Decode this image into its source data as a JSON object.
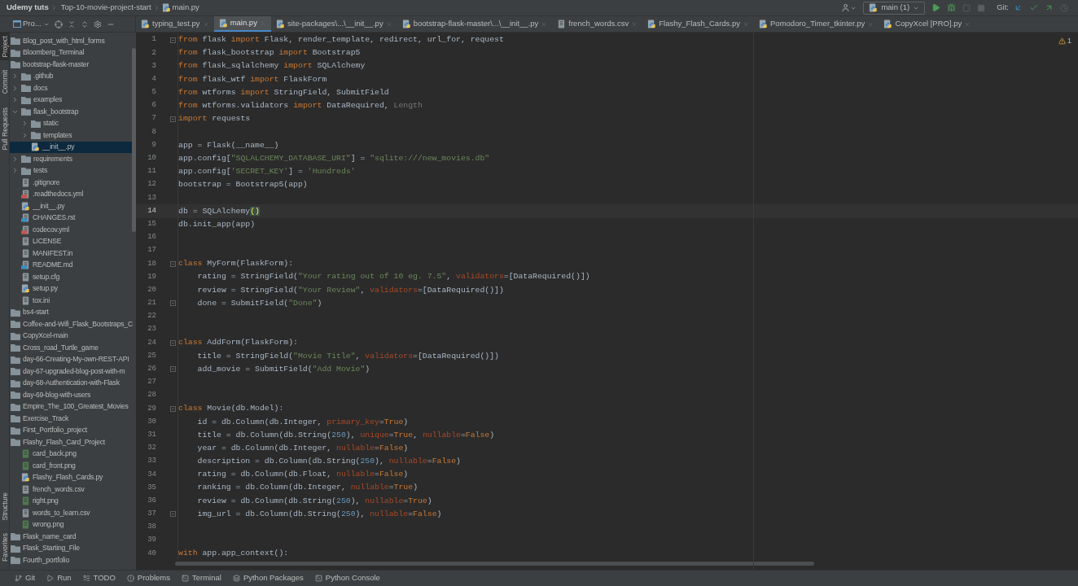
{
  "navbar": {
    "breadcrumbs": [
      {
        "text": "Udemy tuts",
        "kind": "project"
      },
      {
        "text": "Top-10-movie-project-start",
        "kind": "folder"
      },
      {
        "text": "main.py",
        "kind": "file"
      }
    ],
    "run_config": "main (1)",
    "git_label": "Git:"
  },
  "project_panel": {
    "title": "Pro..."
  },
  "tabs": [
    {
      "label": "typing_test.py",
      "kind": "python",
      "selected": false
    },
    {
      "label": "main.py",
      "kind": "python",
      "selected": true
    },
    {
      "label": "site-packages\\...\\__init__.py",
      "kind": "python",
      "selected": false
    },
    {
      "label": "bootstrap-flask-master\\...\\__init__.py",
      "kind": "python",
      "selected": false
    },
    {
      "label": "french_words.csv",
      "kind": "text",
      "selected": false
    },
    {
      "label": "Flashy_Flash_Cards.py",
      "kind": "python",
      "selected": false
    },
    {
      "label": "Pomodoro_Timer_tkinter.py",
      "kind": "python",
      "selected": false
    },
    {
      "label": "CopyXcel [PRO].py",
      "kind": "python",
      "selected": false
    }
  ],
  "tool_stripe": {
    "top": [
      {
        "label": "Project",
        "selected": true
      },
      {
        "label": "Commit",
        "selected": false
      },
      {
        "label": "Pull Requests",
        "selected": false
      }
    ],
    "bottom": [
      {
        "label": "Structure",
        "selected": false
      },
      {
        "label": "Favorites",
        "selected": false
      }
    ]
  },
  "tree": [
    {
      "name": "Blog_post_with_html_forms",
      "kind": "folder",
      "selected": false
    },
    {
      "name": "Bloomberg_Terminal",
      "kind": "folder",
      "selected": false
    },
    {
      "name": "bootstrap-flask-master",
      "kind": "folder",
      "selected": false,
      "children": [
        {
          "name": ".github",
          "kind": "folder",
          "expanded": false,
          "selected": false
        },
        {
          "name": "docs",
          "kind": "folder",
          "expanded": false,
          "selected": false
        },
        {
          "name": "examples",
          "kind": "folder",
          "expanded": false,
          "selected": false
        },
        {
          "name": "flask_bootstrap",
          "kind": "folder",
          "expanded": true,
          "selected": false,
          "children": [
            {
              "name": "static",
              "kind": "folder",
              "expanded": false,
              "selected": false
            },
            {
              "name": "templates",
              "kind": "folder",
              "expanded": false,
              "selected": false
            },
            {
              "name": "__init__.py",
              "kind": "python",
              "selected": true
            }
          ]
        },
        {
          "name": "requirements",
          "kind": "folder",
          "expanded": false,
          "selected": false
        },
        {
          "name": "tests",
          "kind": "folder",
          "expanded": false,
          "selected": false
        },
        {
          "name": ".gitignore",
          "kind": "text",
          "selected": false
        },
        {
          "name": ".readthedocs.yml",
          "kind": "yaml",
          "selected": false
        },
        {
          "name": "__init__.py",
          "kind": "python",
          "selected": false
        },
        {
          "name": "CHANGES.rst",
          "kind": "rst",
          "selected": false
        },
        {
          "name": "codecov.yml",
          "kind": "yaml",
          "selected": false
        },
        {
          "name": "LICENSE",
          "kind": "text",
          "selected": false
        },
        {
          "name": "MANIFEST.in",
          "kind": "text",
          "selected": false
        },
        {
          "name": "README.md",
          "kind": "markdown",
          "selected": false
        },
        {
          "name": "setup.cfg",
          "kind": "text",
          "selected": false
        },
        {
          "name": "setup.py",
          "kind": "python",
          "selected": false
        },
        {
          "name": "tox.ini",
          "kind": "text",
          "selected": false
        }
      ]
    },
    {
      "name": "bs4-start",
      "kind": "folder",
      "selected": false
    },
    {
      "name": "Coffee-and-Wifi_Flask_Bootstraps_C",
      "kind": "folder",
      "selected": false
    },
    {
      "name": "CopyXcel-main",
      "kind": "folder",
      "selected": false
    },
    {
      "name": "Cross_road_Turtle_game",
      "kind": "folder",
      "selected": false
    },
    {
      "name": "day-66-Creating-My-own-REST-API",
      "kind": "folder",
      "selected": false
    },
    {
      "name": "day-67-upgraded-blog-post-with-m",
      "kind": "folder",
      "selected": false
    },
    {
      "name": "day-68-Authentication-with-Flask",
      "kind": "folder",
      "selected": false
    },
    {
      "name": "day-69-blog-with-users",
      "kind": "folder",
      "selected": false
    },
    {
      "name": "Empire_The_100_Greatest_Movies",
      "kind": "folder",
      "selected": false
    },
    {
      "name": "Exercise_Track",
      "kind": "folder",
      "selected": false
    },
    {
      "name": "First_Portfolio_project",
      "kind": "folder",
      "selected": false
    },
    {
      "name": "Flashy_Flash_Card_Project",
      "kind": "folder",
      "selected": false,
      "children": [
        {
          "name": "card_back.png",
          "kind": "image",
          "selected": false
        },
        {
          "name": "card_front.png",
          "kind": "image",
          "selected": false
        },
        {
          "name": "Flashy_Flash_Cards.py",
          "kind": "python",
          "selected": false
        },
        {
          "name": "french_words.csv",
          "kind": "text",
          "selected": false
        },
        {
          "name": "right.png",
          "kind": "image",
          "selected": false
        },
        {
          "name": "words_to_learn.csv",
          "kind": "text",
          "selected": false
        },
        {
          "name": "wrong.png",
          "kind": "image",
          "selected": false
        }
      ]
    },
    {
      "name": "Flask_name_card",
      "kind": "folder",
      "selected": false
    },
    {
      "name": "Flask_Starting_File",
      "kind": "folder",
      "selected": false
    },
    {
      "name": "Fourth_portfolio",
      "kind": "folder",
      "selected": false
    }
  ],
  "editor": {
    "warning_count": "1",
    "lines": [
      {
        "number": "1",
        "current": false,
        "fold": true,
        "tokens": [
          {
            "kind": "kw",
            "text": "from"
          },
          {
            "kind": "txt",
            "text": " flask "
          },
          {
            "kind": "kw",
            "text": "import"
          },
          {
            "kind": "txt",
            "text": " Flask, render_template, redirect, url_for, request"
          }
        ]
      },
      {
        "number": "2",
        "current": false,
        "fold": false,
        "tokens": [
          {
            "kind": "kw",
            "text": "from"
          },
          {
            "kind": "txt",
            "text": " flask_bootstrap "
          },
          {
            "kind": "kw",
            "text": "import"
          },
          {
            "kind": "txt",
            "text": " Bootstrap5"
          }
        ]
      },
      {
        "number": "3",
        "current": false,
        "fold": false,
        "tokens": [
          {
            "kind": "kw",
            "text": "from"
          },
          {
            "kind": "txt",
            "text": " flask_sqlalchemy "
          },
          {
            "kind": "kw",
            "text": "import"
          },
          {
            "kind": "txt",
            "text": " SQLAlchemy"
          }
        ]
      },
      {
        "number": "4",
        "current": false,
        "fold": false,
        "tokens": [
          {
            "kind": "kw",
            "text": "from"
          },
          {
            "kind": "txt",
            "text": " flask_wtf "
          },
          {
            "kind": "kw",
            "text": "import"
          },
          {
            "kind": "txt",
            "text": " FlaskForm"
          }
        ]
      },
      {
        "number": "5",
        "current": false,
        "fold": false,
        "tokens": [
          {
            "kind": "kw",
            "text": "from"
          },
          {
            "kind": "txt",
            "text": " wtforms "
          },
          {
            "kind": "kw",
            "text": "import"
          },
          {
            "kind": "txt",
            "text": " StringField, SubmitField"
          }
        ]
      },
      {
        "number": "6",
        "current": false,
        "fold": false,
        "tokens": [
          {
            "kind": "kw",
            "text": "from"
          },
          {
            "kind": "txt",
            "text": " wtforms.validators "
          },
          {
            "kind": "kw",
            "text": "import"
          },
          {
            "kind": "txt",
            "text": " DataRequired, "
          },
          {
            "kind": "dim",
            "text": "Length"
          }
        ]
      },
      {
        "number": "7",
        "current": false,
        "fold": true,
        "tokens": [
          {
            "kind": "kw",
            "text": "import"
          },
          {
            "kind": "txt",
            "text": " requests"
          }
        ]
      },
      {
        "number": "8",
        "current": false,
        "fold": false
      },
      {
        "number": "9",
        "current": false,
        "fold": false,
        "tokens": [
          {
            "kind": "txt",
            "text": "app = Flask(__name__)"
          }
        ]
      },
      {
        "number": "10",
        "current": false,
        "fold": false,
        "tokens": [
          {
            "kind": "txt",
            "text": "app.config["
          },
          {
            "kind": "str",
            "text": "\"SQLALCHEMY_DATABASE_URI\""
          },
          {
            "kind": "txt",
            "text": "] = "
          },
          {
            "kind": "str",
            "text": "\"sqlite:///new_movies.db\""
          }
        ]
      },
      {
        "number": "11",
        "current": false,
        "fold": false,
        "tokens": [
          {
            "kind": "txt",
            "text": "app.config["
          },
          {
            "kind": "str",
            "text": "'SECRET_KEY'"
          },
          {
            "kind": "txt",
            "text": "] = "
          },
          {
            "kind": "str",
            "text": "'Hundreds'"
          }
        ]
      },
      {
        "number": "12",
        "current": false,
        "fold": false,
        "tokens": [
          {
            "kind": "txt",
            "text": "bootstrap = Bootstrap5(app)"
          }
        ]
      },
      {
        "number": "13",
        "current": false,
        "fold": false
      },
      {
        "number": "14",
        "current": true,
        "fold": false,
        "tokens": [
          {
            "kind": "txt",
            "text": "db = SQLAlchemy"
          },
          {
            "kind": "match",
            "text": "()"
          }
        ]
      },
      {
        "number": "15",
        "current": false,
        "fold": false,
        "tokens": [
          {
            "kind": "txt",
            "text": "db.init_app(app)"
          }
        ]
      },
      {
        "number": "16",
        "current": false,
        "fold": false
      },
      {
        "number": "17",
        "current": false,
        "fold": false
      },
      {
        "number": "18",
        "current": false,
        "fold": true,
        "tokens": [
          {
            "kind": "kw",
            "text": "class"
          },
          {
            "kind": "txt",
            "text": " MyForm(FlaskForm):"
          }
        ]
      },
      {
        "number": "19",
        "current": false,
        "fold": false,
        "tokens": [
          {
            "kind": "txt",
            "text": "    rating = StringField("
          },
          {
            "kind": "str",
            "text": "\"Your rating out of 10 eg. 7.5\""
          },
          {
            "kind": "txt",
            "text": ", "
          },
          {
            "kind": "arg",
            "text": "validators"
          },
          {
            "kind": "txt",
            "text": "=[DataRequired()])"
          }
        ]
      },
      {
        "number": "20",
        "current": false,
        "fold": false,
        "tokens": [
          {
            "kind": "txt",
            "text": "    review = StringField("
          },
          {
            "kind": "str",
            "text": "\"Your Review\""
          },
          {
            "kind": "txt",
            "text": ", "
          },
          {
            "kind": "arg",
            "text": "validators"
          },
          {
            "kind": "txt",
            "text": "=[DataRequired()])"
          }
        ]
      },
      {
        "number": "21",
        "current": false,
        "fold": true,
        "tokens": [
          {
            "kind": "txt",
            "text": "    done = SubmitField("
          },
          {
            "kind": "str",
            "text": "\"Done\""
          },
          {
            "kind": "txt",
            "text": ")"
          }
        ]
      },
      {
        "number": "22",
        "current": false,
        "fold": false
      },
      {
        "number": "23",
        "current": false,
        "fold": false
      },
      {
        "number": "24",
        "current": false,
        "fold": true,
        "tokens": [
          {
            "kind": "kw",
            "text": "class"
          },
          {
            "kind": "txt",
            "text": " AddForm(FlaskForm):"
          }
        ]
      },
      {
        "number": "25",
        "current": false,
        "fold": false,
        "tokens": [
          {
            "kind": "txt",
            "text": "    title = StringField("
          },
          {
            "kind": "str",
            "text": "\"Movie Title\""
          },
          {
            "kind": "txt",
            "text": ", "
          },
          {
            "kind": "arg",
            "text": "validators"
          },
          {
            "kind": "txt",
            "text": "=[DataRequired()])"
          }
        ]
      },
      {
        "number": "26",
        "current": false,
        "fold": true,
        "tokens": [
          {
            "kind": "txt",
            "text": "    add_movie = SubmitField("
          },
          {
            "kind": "str",
            "text": "\"Add Movie\""
          },
          {
            "kind": "txt",
            "text": ")"
          }
        ]
      },
      {
        "number": "27",
        "current": false,
        "fold": false
      },
      {
        "number": "28",
        "current": false,
        "fold": false
      },
      {
        "number": "29",
        "current": false,
        "fold": true,
        "tokens": [
          {
            "kind": "kw",
            "text": "class"
          },
          {
            "kind": "txt",
            "text": " Movie(db.Model):"
          }
        ]
      },
      {
        "number": "30",
        "current": false,
        "fold": false,
        "tokens": [
          {
            "kind": "txt",
            "text": "    id = db.Column(db.Integer, "
          },
          {
            "kind": "arg",
            "text": "primary_key"
          },
          {
            "kind": "txt",
            "text": "="
          },
          {
            "kind": "kw",
            "text": "True"
          },
          {
            "kind": "txt",
            "text": ")"
          }
        ]
      },
      {
        "number": "31",
        "current": false,
        "fold": false,
        "tokens": [
          {
            "kind": "txt",
            "text": "    title = db.Column(db.String("
          },
          {
            "kind": "num",
            "text": "250"
          },
          {
            "kind": "txt",
            "text": "), "
          },
          {
            "kind": "arg",
            "text": "unique"
          },
          {
            "kind": "txt",
            "text": "="
          },
          {
            "kind": "kw",
            "text": "True"
          },
          {
            "kind": "txt",
            "text": ", "
          },
          {
            "kind": "arg",
            "text": "nullable"
          },
          {
            "kind": "txt",
            "text": "="
          },
          {
            "kind": "kw",
            "text": "False"
          },
          {
            "kind": "txt",
            "text": ")"
          }
        ]
      },
      {
        "number": "32",
        "current": false,
        "fold": false,
        "tokens": [
          {
            "kind": "txt",
            "text": "    year = db.Column(db.Integer, "
          },
          {
            "kind": "arg",
            "text": "nullable"
          },
          {
            "kind": "txt",
            "text": "="
          },
          {
            "kind": "kw",
            "text": "False"
          },
          {
            "kind": "txt",
            "text": ")"
          }
        ]
      },
      {
        "number": "33",
        "current": false,
        "fold": false,
        "tokens": [
          {
            "kind": "txt",
            "text": "    description = db.Column(db.String("
          },
          {
            "kind": "num",
            "text": "250"
          },
          {
            "kind": "txt",
            "text": "), "
          },
          {
            "kind": "arg",
            "text": "nullable"
          },
          {
            "kind": "txt",
            "text": "="
          },
          {
            "kind": "kw",
            "text": "False"
          },
          {
            "kind": "txt",
            "text": ")"
          }
        ]
      },
      {
        "number": "34",
        "current": false,
        "fold": false,
        "tokens": [
          {
            "kind": "txt",
            "text": "    rating = db.Column(db.Float, "
          },
          {
            "kind": "arg",
            "text": "nullable"
          },
          {
            "kind": "txt",
            "text": "="
          },
          {
            "kind": "kw",
            "text": "False"
          },
          {
            "kind": "txt",
            "text": ")"
          }
        ]
      },
      {
        "number": "35",
        "current": false,
        "fold": false,
        "tokens": [
          {
            "kind": "txt",
            "text": "    ranking = db.Column(db.Integer, "
          },
          {
            "kind": "arg",
            "text": "nullable"
          },
          {
            "kind": "txt",
            "text": "="
          },
          {
            "kind": "kw",
            "text": "True"
          },
          {
            "kind": "txt",
            "text": ")"
          }
        ]
      },
      {
        "number": "36",
        "current": false,
        "fold": false,
        "tokens": [
          {
            "kind": "txt",
            "text": "    review = db.Column(db.String("
          },
          {
            "kind": "num",
            "text": "250"
          },
          {
            "kind": "txt",
            "text": "), "
          },
          {
            "kind": "arg",
            "text": "nullable"
          },
          {
            "kind": "txt",
            "text": "="
          },
          {
            "kind": "kw",
            "text": "True"
          },
          {
            "kind": "txt",
            "text": ")"
          }
        ]
      },
      {
        "number": "37",
        "current": false,
        "fold": true,
        "tokens": [
          {
            "kind": "txt",
            "text": "    img_url = db.Column(db.String("
          },
          {
            "kind": "num",
            "text": "250"
          },
          {
            "kind": "txt",
            "text": "), "
          },
          {
            "kind": "arg",
            "text": "nullable"
          },
          {
            "kind": "txt",
            "text": "="
          },
          {
            "kind": "kw",
            "text": "False"
          },
          {
            "kind": "txt",
            "text": ")"
          }
        ]
      },
      {
        "number": "38",
        "current": false,
        "fold": false
      },
      {
        "number": "39",
        "current": false,
        "fold": false
      },
      {
        "number": "40",
        "current": false,
        "fold": false,
        "tokens": [
          {
            "kind": "kw",
            "text": "with"
          },
          {
            "kind": "txt",
            "text": " app.app_context():"
          }
        ]
      }
    ]
  },
  "bottom_bar": [
    {
      "label": "Git",
      "kind": "git"
    },
    {
      "label": "Run",
      "kind": "run"
    },
    {
      "label": "TODO",
      "kind": "todo"
    },
    {
      "label": "Problems",
      "kind": "problems"
    },
    {
      "label": "Terminal",
      "kind": "terminal"
    },
    {
      "label": "Python Packages",
      "kind": "packages"
    },
    {
      "label": "Python Console",
      "kind": "console"
    }
  ]
}
